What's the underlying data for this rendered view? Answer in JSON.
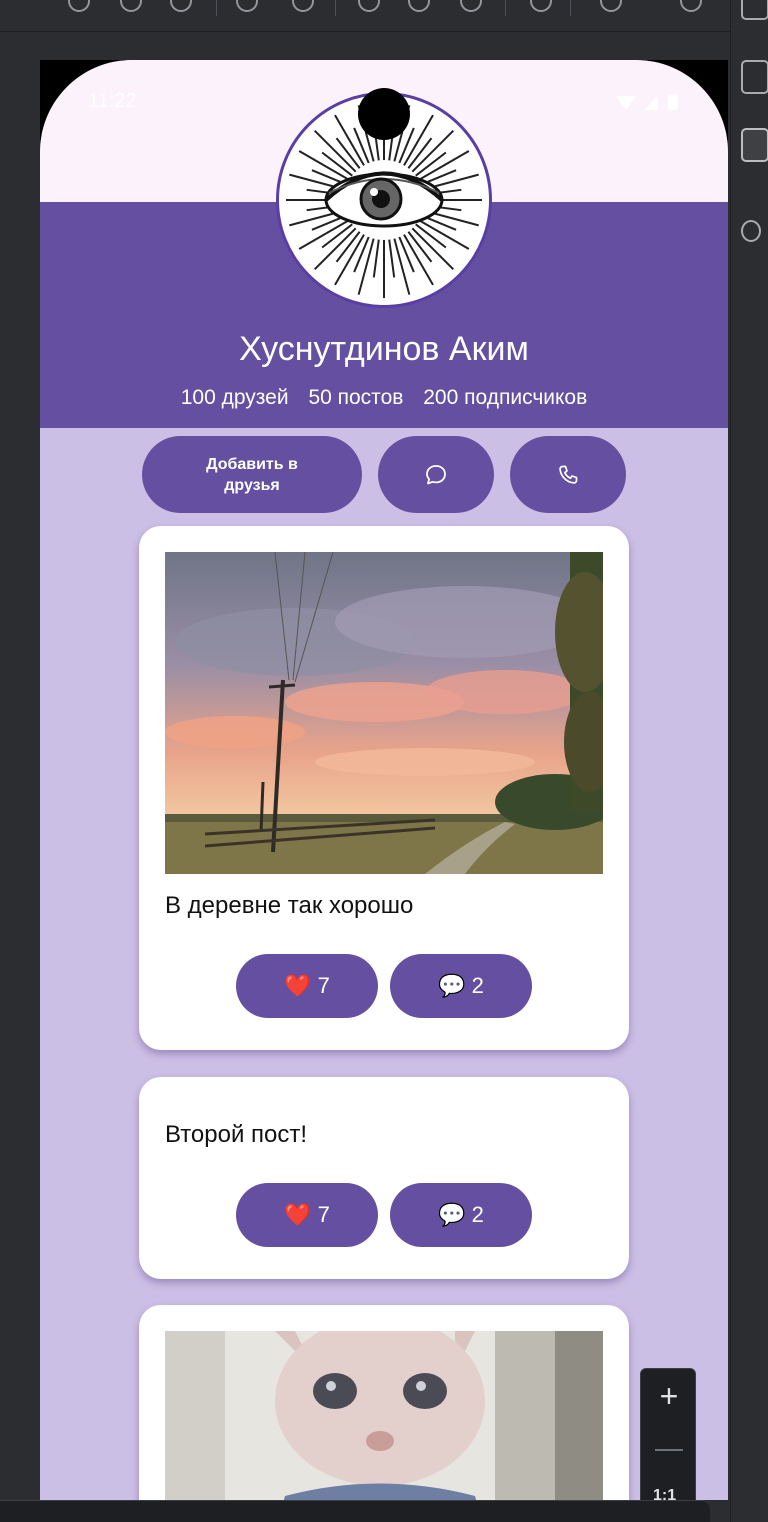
{
  "status_bar": {
    "time": "11:22"
  },
  "profile": {
    "name": "Хуснутдинов Аким",
    "stats": {
      "friends": "100 друзей",
      "posts": "50 постов",
      "followers": "200 подписчиков"
    }
  },
  "actions": {
    "add_friend_line1": "Добавить в",
    "add_friend_line2": "друзья",
    "message_icon": "chat-bubble-icon",
    "call_icon": "phone-icon"
  },
  "posts": [
    {
      "text": "В деревне так хорошо",
      "likes": "7",
      "comments": "2",
      "has_image": true,
      "image": "sunset-countryside-photo"
    },
    {
      "text": "Второй пост!",
      "likes": "7",
      "comments": "2",
      "has_image": false
    },
    {
      "text": "",
      "has_image": true,
      "image": "sphynx-cat-photo"
    }
  ],
  "reaction_icons": {
    "like": "❤️",
    "comment": "💬"
  },
  "zoom_controls": {
    "plus": "+",
    "ratio": "1:1"
  },
  "colors": {
    "primary": "#654fa0",
    "background": "#ccbfe6",
    "card": "#ffffff"
  }
}
